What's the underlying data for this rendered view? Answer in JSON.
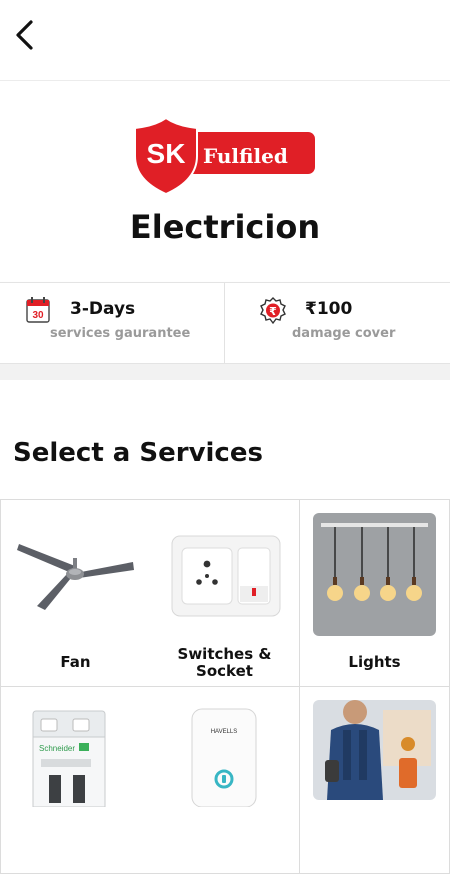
{
  "header": {
    "back_icon": "back-arrow-icon"
  },
  "brand": {
    "logo_initials": "SK",
    "logo_word": "Fulfiled",
    "logo_color": "#e01f26",
    "title": "Electricion"
  },
  "stats": [
    {
      "icon": "calendar-icon",
      "calendar_day": "30",
      "value": "3-Days",
      "label": "services gaurantee"
    },
    {
      "icon": "rupee-badge-icon",
      "value": "₹100",
      "label": "damage cover"
    }
  ],
  "services": {
    "title": "Select a Services",
    "items": [
      {
        "label_line1": "Fan",
        "label_line2": ""
      },
      {
        "label_line1": "Switches &",
        "label_line2": "Socket"
      },
      {
        "label_line1": "Lights",
        "label_line2": ""
      },
      {
        "label_line1": "",
        "label_line2": ""
      },
      {
        "label_line1": "",
        "label_line2": ""
      },
      {
        "label_line1": "",
        "label_line2": ""
      }
    ],
    "mcb_brand": "Schneider",
    "stabilizer_brand": "HAVELLS"
  }
}
